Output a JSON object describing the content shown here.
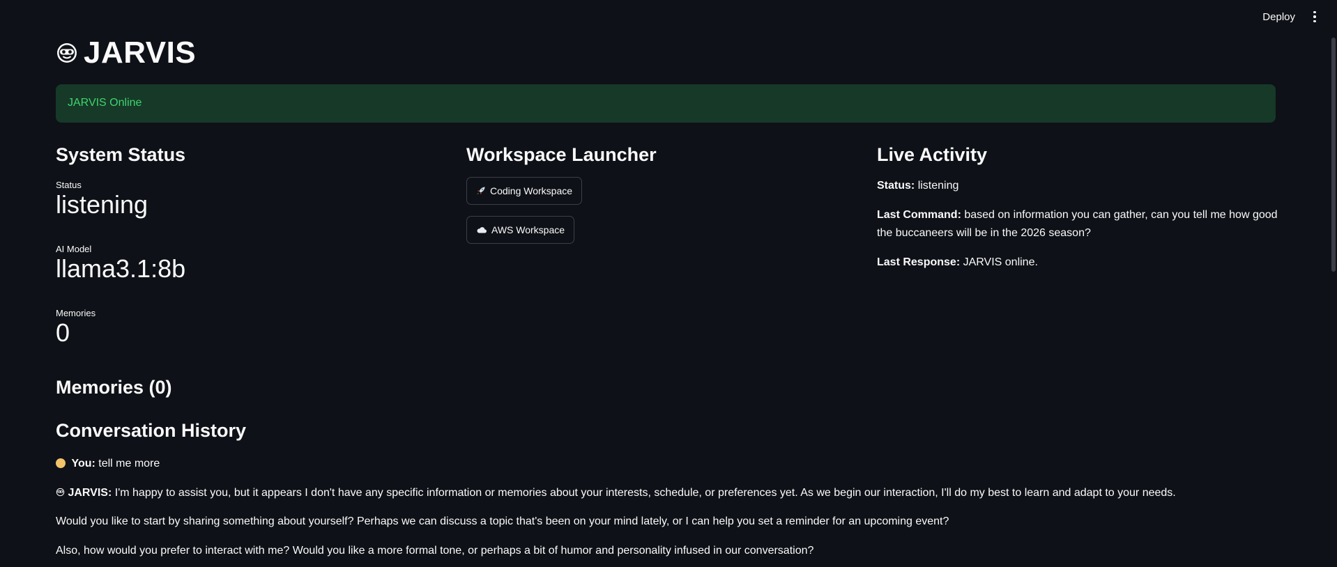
{
  "header": {
    "deploy_label": "Deploy",
    "menu_icon": "kebab-menu-icon"
  },
  "app": {
    "title": "JARVIS",
    "title_icon": "robot-face-icon"
  },
  "alert": {
    "text": "JARVIS Online",
    "color": "#3dd56d",
    "background": "#173928"
  },
  "system_status": {
    "heading": "System Status",
    "metrics": [
      {
        "label": "Status",
        "value": "listening"
      },
      {
        "label": "AI Model",
        "value": "llama3.1:8b"
      },
      {
        "label": "Memories",
        "value": "0"
      }
    ]
  },
  "workspace_launcher": {
    "heading": "Workspace Launcher",
    "buttons": [
      {
        "icon": "rocket-icon",
        "label": "Coding Workspace"
      },
      {
        "icon": "cloud-icon",
        "label": "AWS Workspace"
      }
    ]
  },
  "live_activity": {
    "heading": "Live Activity",
    "status_key": "Status:",
    "status_value": "listening",
    "last_command_key": "Last Command:",
    "last_command_value": "based on information you can gather, can you tell me how good the buccaneers will be in the 2026 season?",
    "last_response_key": "Last Response:",
    "last_response_value": "JARVIS online."
  },
  "memories": {
    "heading": "Memories (0)"
  },
  "conversation": {
    "heading": "Conversation History",
    "you_label": "You:",
    "you_text": "tell me more",
    "jarvis_label": "JARVIS:",
    "jarvis_text": "I'm happy to assist you, but it appears I don't have any specific information or memories about your interests, schedule, or preferences yet. As we begin our interaction, I'll do my best to learn and adapt to your needs.",
    "para2": "Would you like to start by sharing something about yourself? Perhaps we can discuss a topic that's been on your mind lately, or I can help you set a reminder for an upcoming event?",
    "para3": "Also, how would you prefer to interact with me? Would you like a more formal tone, or perhaps a bit of humor and personality infused in our conversation?"
  }
}
